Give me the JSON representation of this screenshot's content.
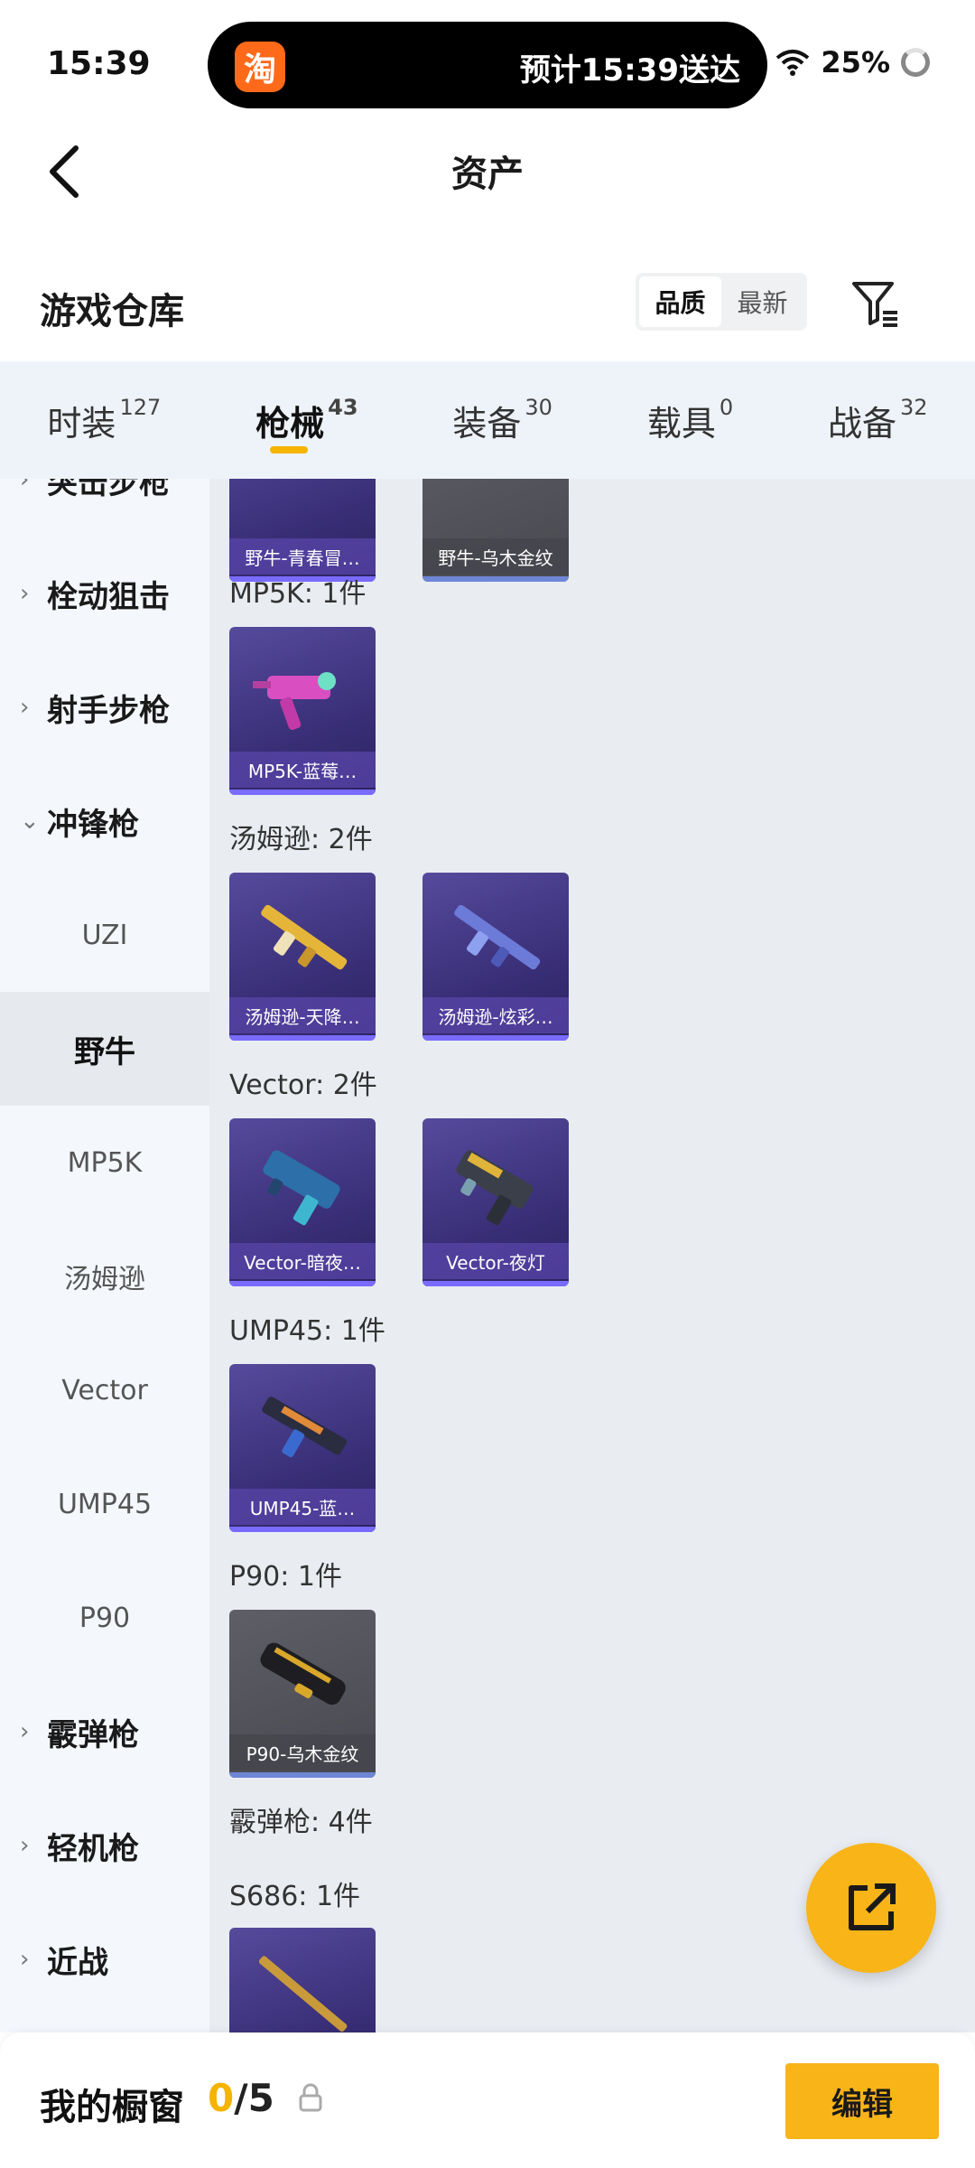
{
  "status": {
    "time": "15:39",
    "island_logo": "淘",
    "island_text": "预计15:39送达",
    "battery": "25%"
  },
  "nav": {
    "title": "资产"
  },
  "warehouse": {
    "title": "游戏仓库",
    "sort_quality": "品质",
    "sort_newest": "最新"
  },
  "tabs": [
    {
      "label": "时装",
      "count": "127"
    },
    {
      "label": "枪械",
      "count": "43"
    },
    {
      "label": "装备",
      "count": "30"
    },
    {
      "label": "载具",
      "count": "0"
    },
    {
      "label": "战备",
      "count": "32"
    }
  ],
  "sidebar": {
    "items": [
      {
        "label": "突击步枪",
        "type": "category"
      },
      {
        "label": "栓动狙击",
        "type": "category"
      },
      {
        "label": "射手步枪",
        "type": "category"
      },
      {
        "label": "冲锋枪",
        "type": "category-open"
      },
      {
        "label": "UZI",
        "type": "sub"
      },
      {
        "label": "野牛",
        "type": "sub-selected"
      },
      {
        "label": "MP5K",
        "type": "sub"
      },
      {
        "label": "汤姆逊",
        "type": "sub"
      },
      {
        "label": "Vector",
        "type": "sub"
      },
      {
        "label": "UMP45",
        "type": "sub"
      },
      {
        "label": "P90",
        "type": "sub"
      },
      {
        "label": "霰弹枪",
        "type": "category"
      },
      {
        "label": "轻机枪",
        "type": "category"
      },
      {
        "label": "近战",
        "type": "category"
      }
    ]
  },
  "main": {
    "groups": [
      {
        "title": "",
        "cards": [
          {
            "label": "野牛-青春冒…",
            "style": "purple"
          },
          {
            "label": "野牛-乌木金纹",
            "style": "grey"
          }
        ]
      },
      {
        "title": "MP5K: 1件",
        "cards": [
          {
            "label": "MP5K-蓝莓…",
            "style": "purple"
          }
        ]
      },
      {
        "title": "汤姆逊: 2件",
        "cards": [
          {
            "label": "汤姆逊-天降…",
            "style": "purple"
          },
          {
            "label": "汤姆逊-炫彩…",
            "style": "purple"
          }
        ]
      },
      {
        "title": "Vector: 2件",
        "cards": [
          {
            "label": "Vector-暗夜…",
            "style": "purple"
          },
          {
            "label": "Vector-夜灯",
            "style": "purple"
          }
        ]
      },
      {
        "title": "UMP45: 1件",
        "cards": [
          {
            "label": "UMP45-蓝…",
            "style": "purple"
          }
        ]
      },
      {
        "title": "P90: 1件",
        "cards": [
          {
            "label": "P90-乌木金纹",
            "style": "grey"
          }
        ]
      },
      {
        "title": "霰弹枪: 4件",
        "cards": []
      },
      {
        "title": "S686: 1件",
        "cards": [
          {
            "label": "",
            "style": "purple"
          }
        ]
      }
    ]
  },
  "bottom": {
    "showcase_label": "我的橱窗",
    "showcase_current": "0",
    "showcase_total": "/5",
    "edit_label": "编辑"
  },
  "colors": {
    "accent": "#f9b418",
    "card_purple": "#3a2f78",
    "tab_bg": "#eef3f9",
    "sidebar_bg": "#f4f8fd"
  }
}
